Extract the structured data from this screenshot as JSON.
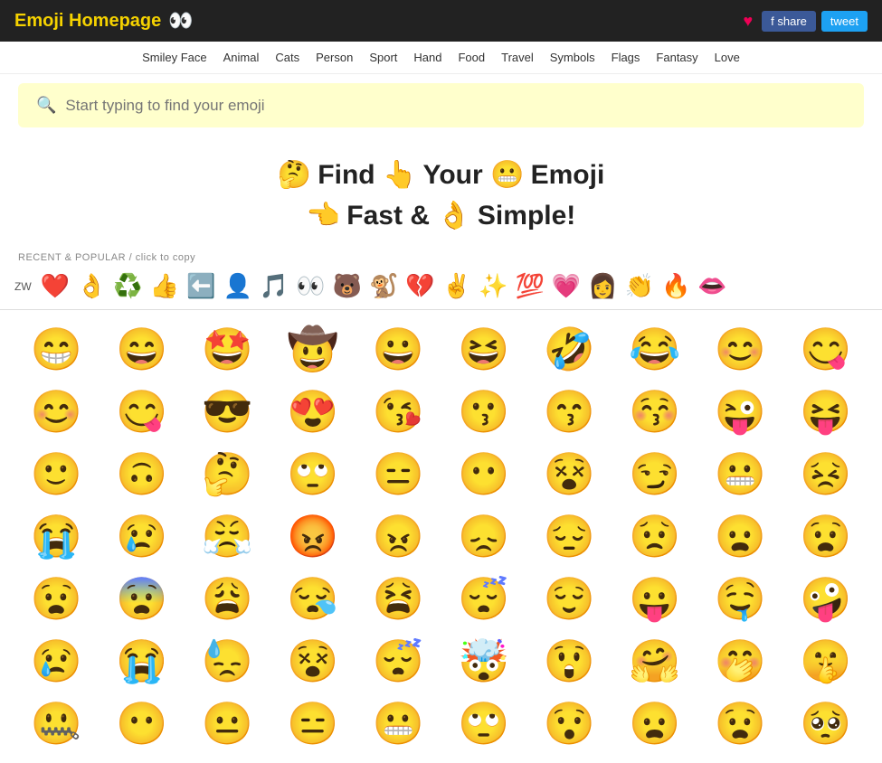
{
  "header": {
    "title": "Emoji Homepage",
    "eyes_icon": "👀",
    "heart_icon": "♥",
    "share_label": "f share",
    "tweet_label": "tweet"
  },
  "nav": {
    "items": [
      {
        "label": "Smiley Face",
        "href": "#"
      },
      {
        "label": "Animal",
        "href": "#"
      },
      {
        "label": "Cats",
        "href": "#"
      },
      {
        "label": "Person",
        "href": "#"
      },
      {
        "label": "Sport",
        "href": "#"
      },
      {
        "label": "Hand",
        "href": "#"
      },
      {
        "label": "Food",
        "href": "#"
      },
      {
        "label": "Travel",
        "href": "#"
      },
      {
        "label": "Symbols",
        "href": "#"
      },
      {
        "label": "Flags",
        "href": "#"
      },
      {
        "label": "Fantasy",
        "href": "#"
      },
      {
        "label": "Love",
        "href": "#"
      }
    ]
  },
  "search": {
    "placeholder": "Start typing to find your emoji"
  },
  "hero": {
    "line1_pre": " Find ",
    "line1_emoji1": "🤔",
    "line1_mid": " Your ",
    "line1_emoji2": "👆",
    "line1_emoji3": "😬",
    "line1_post": " Emoji",
    "line2_emoji1": "👈",
    "line2_pre": " Fast & ",
    "line2_emoji2": "👌",
    "line2_post": " Simple!"
  },
  "recent": {
    "label": "RECENT & POPULAR",
    "sub_label": "/ click to copy",
    "zw": "ZW",
    "emojis": [
      "❤️",
      "👌",
      "♻️",
      "👍",
      "⬅️",
      "👤",
      "🎵",
      "👀",
      "🐻",
      "🐒",
      "💔",
      "✌️",
      "✨",
      "💯",
      "💗",
      "👩",
      "👏",
      "🔥",
      "👄"
    ]
  },
  "emoji_grid": {
    "rows": [
      [
        "😁",
        "😄",
        "🤩",
        "🤠",
        "😀",
        "😆",
        "🤣",
        "😂",
        "😊"
      ],
      [
        "😊",
        "😋",
        "😎",
        "😍",
        "😘",
        "😗",
        "😙",
        "😚",
        "😜"
      ],
      [
        "🙂",
        "🙃",
        "🤔",
        "🙄",
        "😑",
        "😶",
        "😵",
        "😏",
        "😬"
      ],
      [
        "😭",
        "😢",
        "😤",
        "😡",
        "😠",
        "😞",
        "😔",
        "😟",
        "😦"
      ],
      [
        "😧",
        "😨",
        "😩",
        "😪",
        "😫",
        "😴",
        "😌",
        "😛",
        "🤤"
      ]
    ]
  },
  "emojis_display": [
    "😁",
    "😄",
    "🤩",
    "🤠",
    "😀",
    "😆",
    "🤣",
    "😂",
    "😊",
    "😋",
    "😊",
    "😋",
    "😎",
    "😍",
    "😘",
    "😗",
    "😙",
    "😚",
    "😜",
    "😝",
    "🙂",
    "🙃",
    "🤔",
    "🙄",
    "😑",
    "😶",
    "😵",
    "😏",
    "😬",
    "😣",
    "😭",
    "😢",
    "😤",
    "😡",
    "😠",
    "😞",
    "😔",
    "😟",
    "😦",
    "😧",
    "😧",
    "😨",
    "😩",
    "😪",
    "😫",
    "😴",
    "😌",
    "😛",
    "🤤",
    "🤪"
  ]
}
